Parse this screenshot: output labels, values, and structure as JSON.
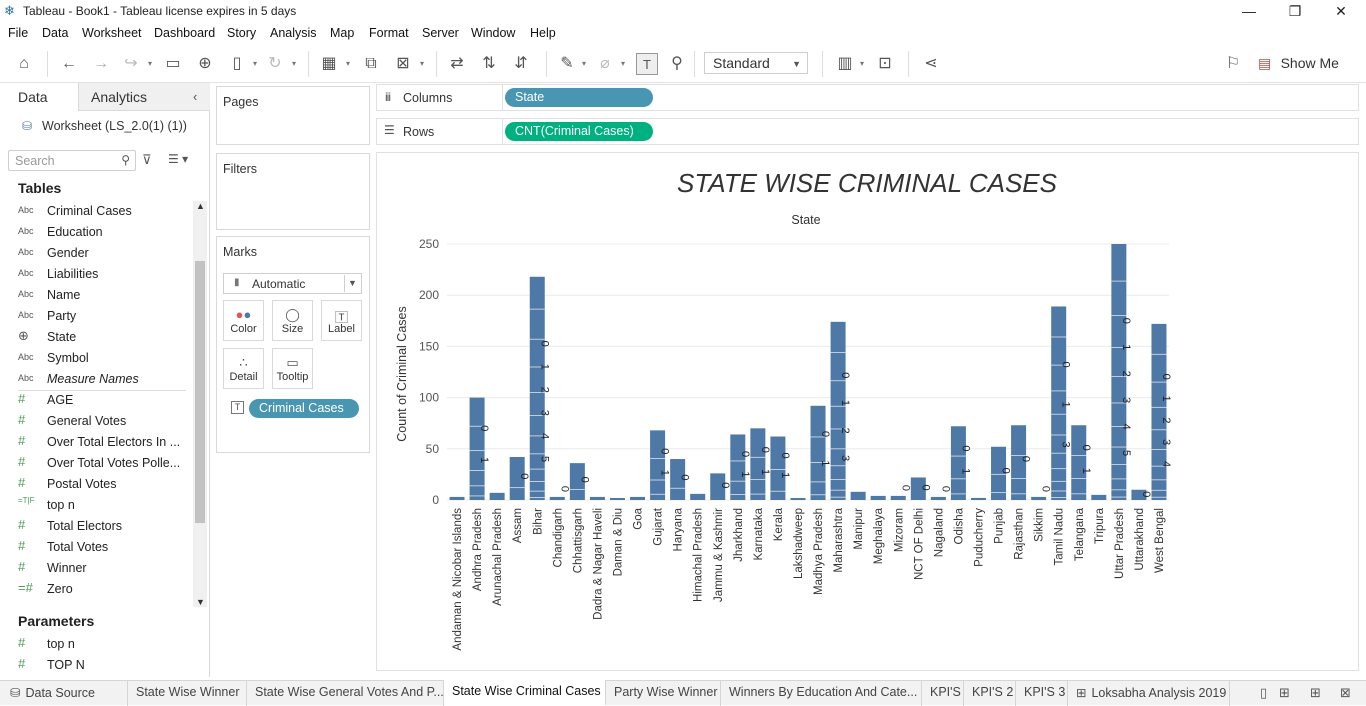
{
  "window": {
    "title": "Tableau - Book1 - Tableau license expires in 5 days",
    "minimize": "—",
    "restore": "❐",
    "close": "✕"
  },
  "menu": [
    "File",
    "Data",
    "Worksheet",
    "Dashboard",
    "Story",
    "Analysis",
    "Map",
    "Format",
    "Server",
    "Window",
    "Help"
  ],
  "toolbar": {
    "fit_select": "Standard",
    "show_me": "Show Me"
  },
  "left_pane": {
    "tab_data": "Data",
    "tab_analytics": "Analytics",
    "datasource": "Worksheet (LS_2.0(1) (1))",
    "search_placeholder": "Search",
    "tables_header": "Tables",
    "fields": [
      {
        "type": "Abc",
        "name": "Criminal Cases"
      },
      {
        "type": "Abc",
        "name": "Education"
      },
      {
        "type": "Abc",
        "name": "Gender"
      },
      {
        "type": "Abc",
        "name": "Liabilities"
      },
      {
        "type": "Abc",
        "name": "Name"
      },
      {
        "type": "Abc",
        "name": "Party"
      },
      {
        "type": "geo",
        "name": "State"
      },
      {
        "type": "Abc",
        "name": "Symbol"
      },
      {
        "type": "Abc",
        "name": "Measure Names"
      },
      {
        "type": "#",
        "name": "AGE"
      },
      {
        "type": "#",
        "name": "General Votes"
      },
      {
        "type": "#",
        "name": "Over Total Electors In ..."
      },
      {
        "type": "#",
        "name": "Over Total Votes Polle..."
      },
      {
        "type": "#",
        "name": "Postal Votes"
      },
      {
        "type": "=T|F",
        "name": "top n"
      },
      {
        "type": "#",
        "name": "Total Electors"
      },
      {
        "type": "#",
        "name": "Total Votes"
      },
      {
        "type": "#",
        "name": "Winner"
      },
      {
        "type": "=#",
        "name": "Zero"
      }
    ],
    "parameters_header": "Parameters",
    "parameters": [
      {
        "type": "#",
        "name": "top n"
      },
      {
        "type": "#",
        "name": "TOP N"
      }
    ]
  },
  "cards": {
    "pages": "Pages",
    "filters": "Filters",
    "marks": "Marks",
    "mark_type": "Automatic",
    "mark_buttons": [
      "Color",
      "Size",
      "Label",
      "Detail",
      "Tooltip"
    ],
    "marks_pill": "Criminal Cases"
  },
  "shelves": {
    "columns_label": "Columns",
    "columns_pill": "State",
    "rows_label": "Rows",
    "rows_pill": "CNT(Criminal Cases)"
  },
  "chart_data": {
    "type": "bar",
    "title": "STATE WISE CRIMINAL CASES",
    "subtitle": "State",
    "xlabel": "",
    "ylabel": "Count of Criminal Cases",
    "ylim": [
      0,
      250
    ],
    "yticks": [
      0,
      50,
      100,
      150,
      200,
      250
    ],
    "grid": true,
    "stacked": true,
    "bar_color": "#4e79a7",
    "categories": [
      "Andaman & Nicobar Islands",
      "Andhra Pradesh",
      "Arunachal Pradesh",
      "Assam",
      "Bihar",
      "Chandigarh",
      "Chhattisgarh",
      "Dadra & Nagar Haveli",
      "Daman & Diu",
      "Goa",
      "Gujarat",
      "Haryana",
      "Himachal Pradesh",
      "Jammu & Kashmir",
      "Jharkhand",
      "Karnataka",
      "Kerala",
      "Lakshadweep",
      "Madhya Pradesh",
      "Maharashtra",
      "Manipur",
      "Meghalaya",
      "Mizoram",
      "NCT OF Delhi",
      "Nagaland",
      "Odisha",
      "Puducherry",
      "Punjab",
      "Rajasthan",
      "Sikkim",
      "Tamil Nadu",
      "Telangana",
      "Tripura",
      "Uttar Pradesh",
      "Uttarakhand",
      "West Bengal"
    ],
    "values": [
      3,
      100,
      7,
      42,
      218,
      3,
      36,
      3,
      1,
      3,
      68,
      40,
      6,
      26,
      64,
      70,
      62,
      1,
      92,
      174,
      8,
      4,
      4,
      22,
      3,
      72,
      2,
      52,
      73,
      3,
      189,
      73,
      5,
      250,
      10,
      172
    ],
    "segment_labels": [
      [],
      [
        "0",
        "1"
      ],
      [],
      [
        "0"
      ],
      [
        "0",
        "1",
        "2",
        "3",
        "4",
        "5"
      ],
      [
        "0"
      ],
      [
        "0"
      ],
      [],
      [],
      [],
      [
        "0",
        "1"
      ],
      [
        "0"
      ],
      [],
      [
        "0"
      ],
      [
        "0",
        "1"
      ],
      [
        "0",
        "1"
      ],
      [
        "0",
        "1"
      ],
      [],
      [
        "0",
        "1"
      ],
      [
        "0",
        "1",
        "2",
        "3"
      ],
      [],
      [],
      [
        "0"
      ],
      [
        "0"
      ],
      [
        "0"
      ],
      [
        "0",
        "1"
      ],
      [],
      [
        "0"
      ],
      [
        "0"
      ],
      [
        "0"
      ],
      [
        "0",
        "1",
        "3"
      ],
      [
        "0",
        "1"
      ],
      [],
      [
        "0",
        "1",
        "2",
        "3",
        "4",
        "5"
      ],
      [
        "0"
      ],
      [
        "0",
        "1",
        "2",
        "3",
        "4"
      ]
    ]
  },
  "sheet_tabs": [
    {
      "label": "Data Source",
      "active": false
    },
    {
      "label": "State Wise Winner",
      "active": false
    },
    {
      "label": "State Wise General Votes And P...",
      "active": false
    },
    {
      "label": "State Wise Criminal Cases",
      "active": true
    },
    {
      "label": "Party Wise Winner",
      "active": false
    },
    {
      "label": "Winners By Education And Cate...",
      "active": false
    },
    {
      "label": "KPI'S",
      "active": false
    },
    {
      "label": "KPI'S 2",
      "active": false
    },
    {
      "label": "KPI'S 3",
      "active": false
    },
    {
      "label": "Loksabha Analysis 2019",
      "active": false
    }
  ]
}
